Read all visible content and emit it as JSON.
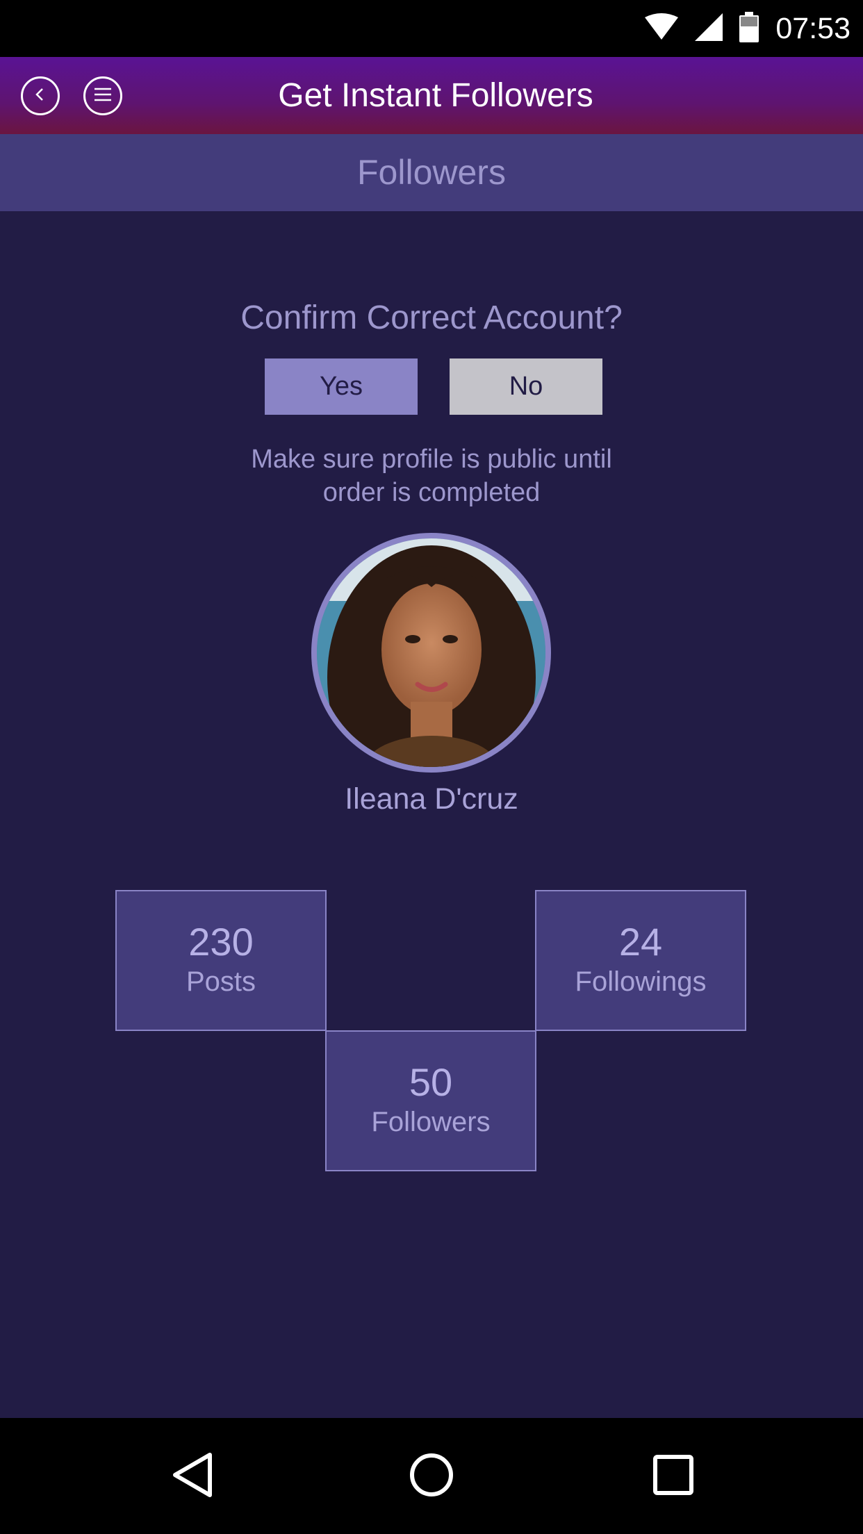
{
  "status": {
    "time": "07:53"
  },
  "app_bar": {
    "title": "Get Instant Followers"
  },
  "sub_header": {
    "title": "Followers"
  },
  "confirm": {
    "question": "Confirm Correct Account?",
    "yes_label": "Yes",
    "no_label": "No",
    "note": "Make sure profile is public until order is completed"
  },
  "profile": {
    "name": "Ileana D'cruz",
    "stats": {
      "posts": {
        "value": "230",
        "label": "Posts"
      },
      "followers": {
        "value": "50",
        "label": "Followers"
      },
      "followings": {
        "value": "24",
        "label": "Followings"
      }
    }
  },
  "colors": {
    "background": "#221c45",
    "accent": "#8a84c6",
    "panel": "#433c7b",
    "app_bar_top": "#5a1394",
    "app_bar_bottom": "#6b1540"
  },
  "icons": [
    "wifi-icon",
    "signal-icon",
    "battery-icon",
    "back-icon",
    "menu-icon",
    "nav-back-icon",
    "nav-home-icon",
    "nav-recents-icon"
  ]
}
